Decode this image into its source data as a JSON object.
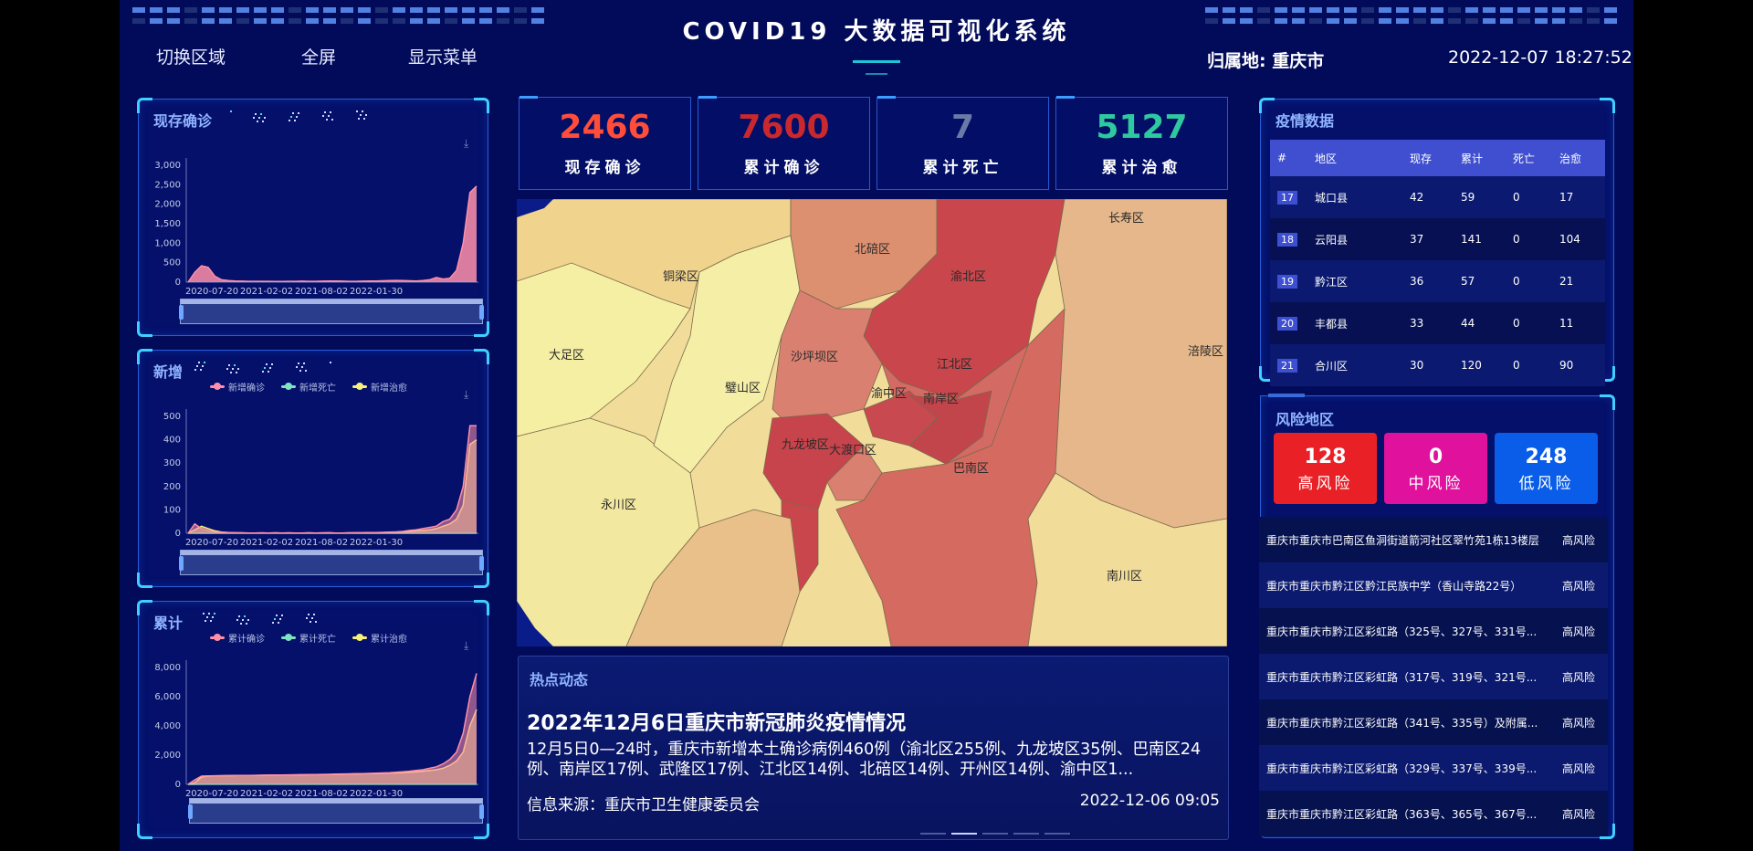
{
  "header": {
    "title": "COVID19 大数据可视化系统",
    "nav": [
      "切换区域",
      "全屏",
      "显示菜单"
    ],
    "location": "归属地: 重庆市",
    "datetime": "2022-12-07 18:27:52"
  },
  "colors": {
    "accent": "#3fd0ff",
    "current_confirmed": "#ff4d3a",
    "total_confirmed": "#c8282e",
    "total_death": "#6a7aa8",
    "total_cured": "#2fc9a0",
    "high_risk": "#ea2027",
    "mid_risk": "#e0119c",
    "low_risk": "#0a5de8",
    "confirmed_series": "#ff8fa8",
    "death_series": "#7de3c2",
    "cured_series": "#f7f07a"
  },
  "left_panels": {
    "current": {
      "title": "现存确诊",
      "icon": "download-icon",
      "chart_data": {
        "type": "area",
        "x_ticks": [
          "2020-07-20",
          "2021-02-02",
          "2021-08-02",
          "2022-01-30"
        ],
        "ylim": [
          0,
          3000
        ],
        "y_ticks": [
          "0",
          "500",
          "1,000",
          "1,500",
          "2,000",
          "2,500",
          "3,000"
        ],
        "series": [
          {
            "name": "",
            "values": [
              0,
              250,
              420,
              380,
              150,
              60,
              40,
              30,
              25,
              20,
              20,
              22,
              20,
              18,
              18,
              20,
              22,
              25,
              20,
              22,
              25,
              28,
              30,
              25,
              20,
              22,
              25,
              28,
              30,
              35,
              40,
              45,
              40,
              35,
              30,
              40,
              60,
              120,
              80,
              100,
              300,
              1000,
              2300,
              2466
            ]
          }
        ]
      }
    },
    "new": {
      "title": "新增",
      "icon": "download-icon",
      "legend": [
        "新增确诊",
        "新增死亡",
        "新增治愈"
      ],
      "chart_data": {
        "type": "line",
        "x_ticks": [
          "2020-07-20",
          "2021-02-02",
          "2021-08-02",
          "2022-01-30"
        ],
        "ylim": [
          0,
          500
        ],
        "y_ticks": [
          "0",
          "100",
          "200",
          "300",
          "400",
          "500"
        ],
        "series": [
          {
            "name": "新增确诊",
            "values": [
              0,
              40,
              20,
              10,
              5,
              3,
              2,
              2,
              1,
              1,
              1,
              2,
              1,
              1,
              1,
              2,
              1,
              1,
              1,
              1,
              2,
              2,
              1,
              1,
              1,
              2,
              2,
              3,
              3,
              4,
              5,
              6,
              8,
              12,
              15,
              20,
              25,
              30,
              50,
              60,
              100,
              200,
              460,
              460
            ]
          },
          {
            "name": "新增死亡",
            "values": [
              0,
              0,
              0,
              0,
              0,
              0,
              0,
              0,
              0,
              0,
              0,
              0,
              0,
              0,
              0,
              0,
              0,
              0,
              0,
              0,
              0,
              0,
              0,
              0,
              0,
              0,
              0,
              0,
              0,
              0,
              0,
              0,
              0,
              0,
              0,
              0,
              0,
              0,
              0,
              0,
              0,
              0,
              0,
              0
            ]
          },
          {
            "name": "新增治愈",
            "values": [
              0,
              15,
              30,
              20,
              10,
              5,
              3,
              2,
              2,
              1,
              1,
              1,
              1,
              2,
              1,
              1,
              1,
              1,
              2,
              1,
              1,
              2,
              1,
              1,
              2,
              2,
              2,
              3,
              3,
              3,
              4,
              5,
              6,
              8,
              10,
              12,
              15,
              20,
              30,
              40,
              60,
              120,
              380,
              400
            ]
          }
        ]
      }
    },
    "total": {
      "title": "累计",
      "icon": "download-icon",
      "legend": [
        "累计确诊",
        "累计死亡",
        "累计治愈"
      ],
      "chart_data": {
        "type": "line",
        "x_ticks": [
          "2020-07-20",
          "2021-02-02",
          "2021-08-02",
          "2022-01-30"
        ],
        "ylim": [
          0,
          8000
        ],
        "y_ticks": [
          "0",
          "2,000",
          "4,000",
          "6,000",
          "8,000"
        ],
        "series": [
          {
            "name": "累计确诊",
            "values": [
              0,
              300,
              560,
              580,
              590,
              595,
              600,
              605,
              610,
              615,
              620,
              625,
              630,
              640,
              645,
              650,
              655,
              660,
              665,
              670,
              680,
              690,
              700,
              710,
              720,
              730,
              740,
              750,
              760,
              780,
              800,
              830,
              860,
              900,
              950,
              1000,
              1100,
              1200,
              1400,
              1700,
              2200,
              3500,
              6000,
              7600
            ]
          },
          {
            "name": "累计死亡",
            "values": [
              0,
              2,
              5,
              6,
              6,
              6,
              6,
              6,
              6,
              6,
              6,
              6,
              6,
              6,
              6,
              6,
              6,
              6,
              6,
              6,
              6,
              6,
              6,
              6,
              6,
              6,
              6,
              6,
              6,
              6,
              6,
              6,
              6,
              6,
              6,
              6,
              6,
              6,
              6,
              7,
              7,
              7,
              7,
              7
            ]
          },
          {
            "name": "累计治愈",
            "values": [
              0,
              100,
              500,
              560,
              580,
              590,
              595,
              600,
              605,
              610,
              615,
              620,
              625,
              630,
              635,
              640,
              645,
              650,
              655,
              660,
              665,
              670,
              680,
              690,
              700,
              710,
              720,
              730,
              740,
              750,
              760,
              780,
              800,
              830,
              860,
              900,
              950,
              1000,
              1100,
              1300,
              1600,
              2200,
              4000,
              5127
            ]
          }
        ]
      }
    }
  },
  "stats": [
    {
      "value": "2466",
      "label": "现存确诊"
    },
    {
      "value": "7600",
      "label": "累计确诊"
    },
    {
      "value": "7",
      "label": "累计死亡"
    },
    {
      "value": "5127",
      "label": "累计治愈"
    }
  ],
  "map": {
    "labels": [
      "长寿区",
      "北碚区",
      "铜梁区",
      "渝北区",
      "大足区",
      "沙坪坝区",
      "涪陵区",
      "江北区",
      "璧山区",
      "渝中区",
      "南岸区",
      "九龙坡区",
      "大渡口区",
      "巴南区",
      "永川区",
      "南川区"
    ]
  },
  "news": {
    "heading": "热点动态",
    "headline": "2022年12月6日重庆市新冠肺炎疫情情况",
    "body": "12月5日0—24时，重庆市新增本土确诊病例460例（渝北区255例、九龙坡区35例、巴南区24例、南岸区17例、武隆区17例、江北区14例、北碚区14例、开州区14例、渝中区1...",
    "source": "信息来源：重庆市卫生健康委员会",
    "date": "2022-12-06 09:05"
  },
  "epidemic": {
    "title": "疫情数据",
    "columns": [
      "#",
      "地区",
      "现存",
      "累计",
      "死亡",
      "治愈"
    ],
    "rows": [
      [
        "17",
        "城口县",
        "42",
        "59",
        "0",
        "17"
      ],
      [
        "18",
        "云阳县",
        "37",
        "141",
        "0",
        "104"
      ],
      [
        "19",
        "黔江区",
        "36",
        "57",
        "0",
        "21"
      ],
      [
        "20",
        "丰都县",
        "33",
        "44",
        "0",
        "11"
      ],
      [
        "21",
        "合川区",
        "30",
        "120",
        "0",
        "90"
      ]
    ]
  },
  "risk": {
    "title": "风险地区",
    "cards": [
      {
        "value": "128",
        "label": "高风险"
      },
      {
        "value": "0",
        "label": "中风险"
      },
      {
        "value": "248",
        "label": "低风险"
      }
    ],
    "list": [
      {
        "place": "重庆市重庆市巴南区鱼洞街道箭河社区翠竹苑1栋13楼层",
        "level": "高风险"
      },
      {
        "place": "重庆市重庆市黔江区黔江民族中学（香山寺路22号）",
        "level": "高风险"
      },
      {
        "place": "重庆市重庆市黔江区彩虹路（325号、327号、331号...",
        "level": "高风险"
      },
      {
        "place": "重庆市重庆市黔江区彩虹路（317号、319号、321号...",
        "level": "高风险"
      },
      {
        "place": "重庆市重庆市黔江区彩虹路（341号、335号）及附属...",
        "level": "高风险"
      },
      {
        "place": "重庆市重庆市黔江区彩虹路（329号、337号、339号...",
        "level": "高风险"
      },
      {
        "place": "重庆市重庆市黔江区彩虹路（363号、365号、367号...",
        "level": "高风险"
      }
    ]
  }
}
